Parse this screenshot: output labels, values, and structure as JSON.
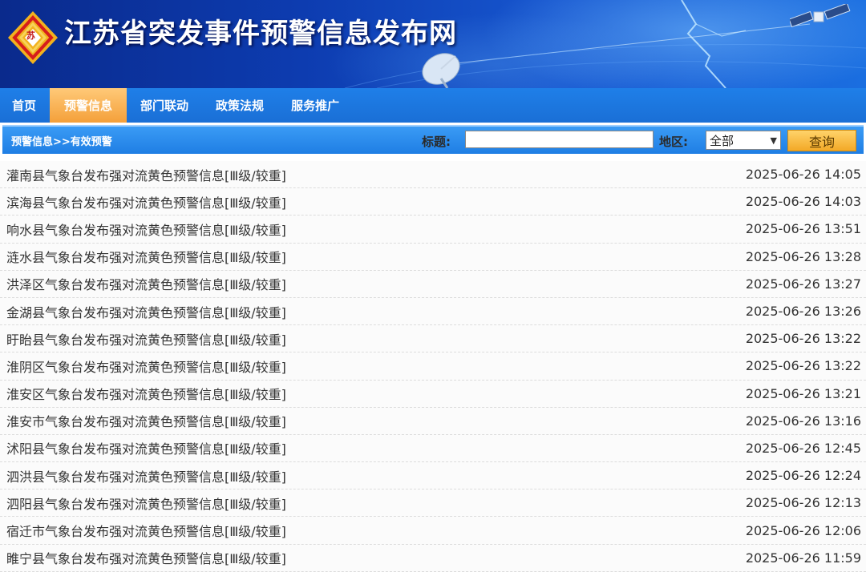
{
  "header": {
    "site_title": "江苏省突发事件预警信息发布网",
    "logo_char": "苏"
  },
  "nav": {
    "items": [
      {
        "label": "首页",
        "active": false
      },
      {
        "label": "预警信息",
        "active": true
      },
      {
        "label": "部门联动",
        "active": false
      },
      {
        "label": "政策法规",
        "active": false
      },
      {
        "label": "服务推广",
        "active": false
      }
    ]
  },
  "filter": {
    "breadcrumb": "预警信息>>有效预警",
    "title_label": "标题:",
    "title_value": "",
    "region_label": "地区:",
    "region_selected": "全部",
    "search_label": "查询"
  },
  "warnings": [
    {
      "title": "灌南县气象台发布强对流黄色预警信息[Ⅲ级/较重]",
      "time": "2025-06-26 14:05"
    },
    {
      "title": "滨海县气象台发布强对流黄色预警信息[Ⅲ级/较重]",
      "time": "2025-06-26 14:03"
    },
    {
      "title": "响水县气象台发布强对流黄色预警信息[Ⅲ级/较重]",
      "time": "2025-06-26 13:51"
    },
    {
      "title": "涟水县气象台发布强对流黄色预警信息[Ⅲ级/较重]",
      "time": "2025-06-26 13:28"
    },
    {
      "title": "洪泽区气象台发布强对流黄色预警信息[Ⅲ级/较重]",
      "time": "2025-06-26 13:27"
    },
    {
      "title": "金湖县气象台发布强对流黄色预警信息[Ⅲ级/较重]",
      "time": "2025-06-26 13:26"
    },
    {
      "title": "盱眙县气象台发布强对流黄色预警信息[Ⅲ级/较重]",
      "time": "2025-06-26 13:22"
    },
    {
      "title": "淮阴区气象台发布强对流黄色预警信息[Ⅲ级/较重]",
      "time": "2025-06-26 13:22"
    },
    {
      "title": "淮安区气象台发布强对流黄色预警信息[Ⅲ级/较重]",
      "time": "2025-06-26 13:21"
    },
    {
      "title": "淮安市气象台发布强对流黄色预警信息[Ⅲ级/较重]",
      "time": "2025-06-26 13:16"
    },
    {
      "title": "沭阳县气象台发布强对流黄色预警信息[Ⅲ级/较重]",
      "time": "2025-06-26 12:45"
    },
    {
      "title": "泗洪县气象台发布强对流黄色预警信息[Ⅲ级/较重]",
      "time": "2025-06-26 12:24"
    },
    {
      "title": "泗阳县气象台发布强对流黄色预警信息[Ⅲ级/较重]",
      "time": "2025-06-26 12:13"
    },
    {
      "title": "宿迁市气象台发布强对流黄色预警信息[Ⅲ级/较重]",
      "time": "2025-06-26 12:06"
    },
    {
      "title": "睢宁县气象台发布强对流黄色预警信息[Ⅲ级/较重]",
      "time": "2025-06-26 11:59"
    }
  ],
  "icons": {
    "logo": "diamond-logo-icon",
    "satellite": "satellite-icon",
    "dish": "satellite-dish-icon",
    "select_arrow": "chevron-down-icon"
  }
}
